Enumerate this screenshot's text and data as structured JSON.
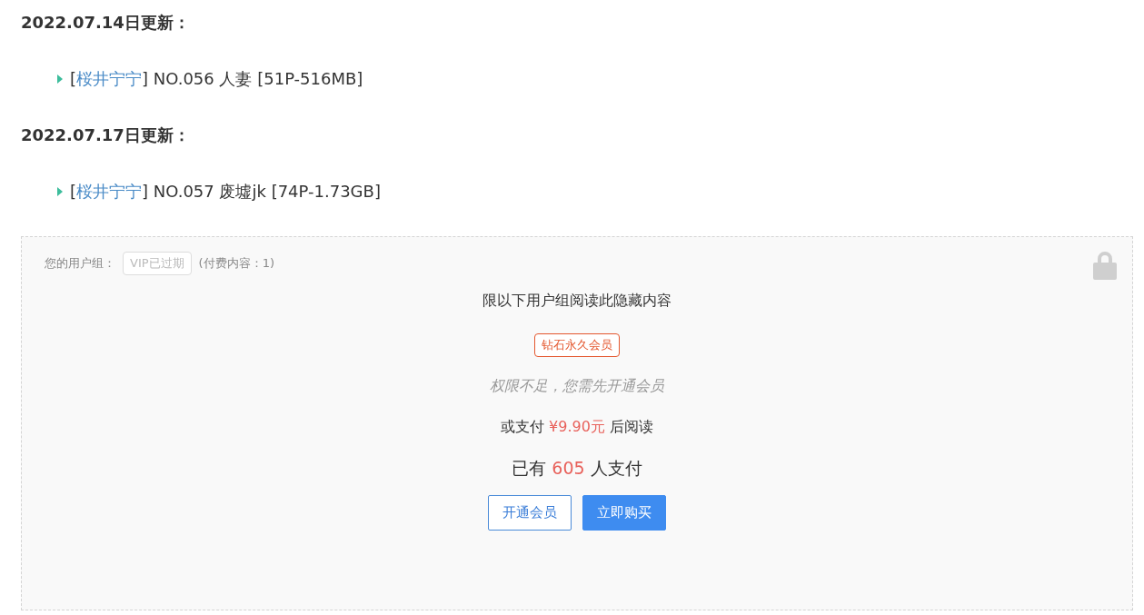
{
  "updates": [
    {
      "date": "2022.07.14日更新：",
      "entries": [
        {
          "open": "[",
          "link": "桜井宁宁",
          "rest": "] NO.056 人妻 [51P-516MB]"
        }
      ]
    },
    {
      "date": "2022.07.17日更新：",
      "entries": [
        {
          "open": "[",
          "link": "桜井宁宁",
          "rest": "] NO.057 废墟jk [74P-1.73GB]"
        }
      ]
    }
  ],
  "paywall": {
    "group_label": "您的用户组：",
    "group_badge": "VIP已过期",
    "paid_count": "(付费内容：1)",
    "restriction": "限以下用户组阅读此隐藏内容",
    "required_group": "钻石永久会员",
    "notice": "权限不足，您需先开通会员",
    "pay_prefix": "或支付",
    "price": "¥9.90元",
    "pay_suffix": "后阅读",
    "buyers_prefix": "已有",
    "buyers": "605",
    "buyers_suffix": "人支付",
    "buttons": [
      {
        "label": "开通会员",
        "kind": "outline"
      },
      {
        "label": "立即购买",
        "kind": "primary"
      }
    ]
  }
}
